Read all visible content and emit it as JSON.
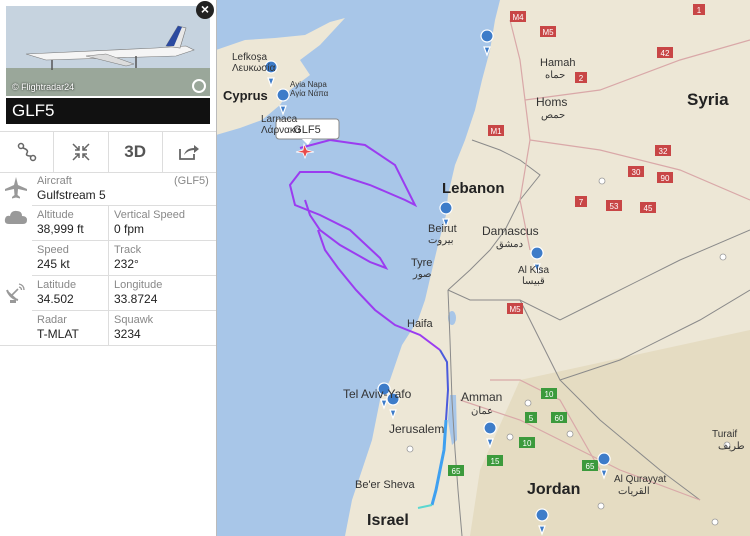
{
  "aircraft_panel": {
    "close_label": "×",
    "photo_credit": "© Flightradar24",
    "callsign": "GLF5",
    "toolbar": {
      "route_icon": "route-icon",
      "fit_icon": "collapse-icon",
      "view3d_label": "3D",
      "share_icon": "share-icon"
    },
    "aircraft_label": "Aircraft",
    "aircraft_code": "(GLF5)",
    "aircraft_model": "Gulfstream 5",
    "altitude_label": "Altitude",
    "altitude_value": "38,999 ft",
    "vs_label": "Vertical Speed",
    "vs_value": "0 fpm",
    "speed_label": "Speed",
    "speed_value": "245 kt",
    "track_label": "Track",
    "track_value": "232°",
    "lat_label": "Latitude",
    "lat_value": "34.502",
    "lon_label": "Longitude",
    "lon_value": "33.8724",
    "radar_label": "Radar",
    "radar_value": "T-MLAT",
    "squawk_label": "Squawk",
    "squawk_value": "3234"
  },
  "map": {
    "flight_label": "GLF5",
    "countries": {
      "syria": "Syria",
      "lebanon": "Lebanon",
      "jordan": "Jordan",
      "israel": "Israel",
      "cyprus": "Cyprus"
    },
    "cities": {
      "lefkosa": "Lefkoşa",
      "lefkosa_gr": "Λευκωσία",
      "ayia_napa": "Ayia Napa",
      "ayia_napa_gr": "Αγία Νάπα",
      "larnaca": "Larnaca",
      "larnaca_gr": "Λάρνακα",
      "hamah": "Hamah",
      "hamah_ar": "حماه",
      "homs": "Homs",
      "homs_ar": "حمص",
      "beirut": "Beirut",
      "beirut_ar": "بيروت",
      "damascus": "Damascus",
      "damascus_ar": "دمشق",
      "alkisa": "Al Kisa",
      "alkisa_ar": "قبيسا",
      "tyre": "Tyre",
      "tyre_ar": "صور",
      "haifa": "Haifa",
      "telaviv": "Tel Aviv-Yafo",
      "jerusalem": "Jerusalem",
      "amman": "Amman",
      "amman_ar": "عمان",
      "beersheva": "Be'er Sheva",
      "turaif": "Turaif",
      "turaif_ar": "طريف",
      "alqurayyat": "Al Qurayyat",
      "alqurayyat_ar": "القريات"
    },
    "road_shields": {
      "m4": "M4",
      "m5a": "M5",
      "m1": "M1",
      "m5b": "M5",
      "r42": "42",
      "r32": "32",
      "r30": "30",
      "r90": "90",
      "r7": "7",
      "r53": "53",
      "r45": "45",
      "r10a": "10",
      "r15": "15",
      "r65a": "65",
      "r65b": "65",
      "r60": "60",
      "r10b": "10",
      "r5": "5",
      "r1": "1",
      "r2": "2"
    },
    "colors": {
      "sea": "#a8c6e8",
      "land": "#ede7d6",
      "track_primary": "#9b3cf0",
      "track_secondary": "#4b5bdc",
      "track_descent": "#3fa0f0",
      "road_shield": "#c84646",
      "road_shield_green": "#3c9a3c"
    }
  }
}
